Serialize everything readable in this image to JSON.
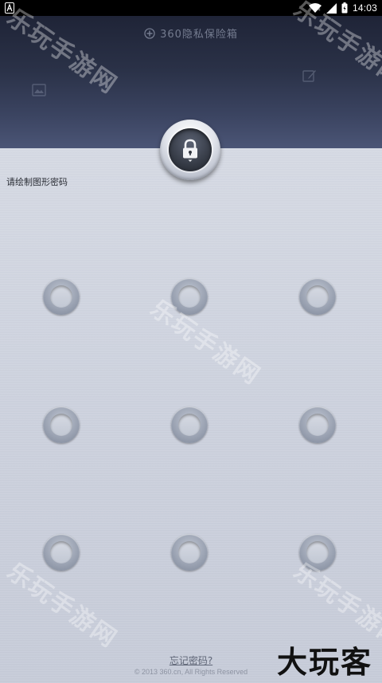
{
  "status_bar": {
    "time": "14:03",
    "left_icon": "a-notification-icon",
    "icons": [
      "wifi-icon",
      "signal-icon",
      "battery-icon"
    ]
  },
  "header": {
    "title": "360隐私保险箱",
    "title_icon": "plus-circle-icon",
    "left_icon": "image-icon",
    "right_icon": "edit-icon"
  },
  "lock": {
    "icon": "padlock-icon"
  },
  "prompt": "请绘制图形密码",
  "pattern": {
    "rows": 3,
    "cols": 3
  },
  "footer": {
    "forgot_label": "忘记密码?",
    "copyright": "© 2013 360.cn, All Rights Reserved"
  },
  "watermarks": {
    "text": "乐玩手游网",
    "corner": "大玩客"
  },
  "colors": {
    "header_top": "#1f2437",
    "header_bottom": "#4b5576",
    "body": "#cfd4df"
  }
}
